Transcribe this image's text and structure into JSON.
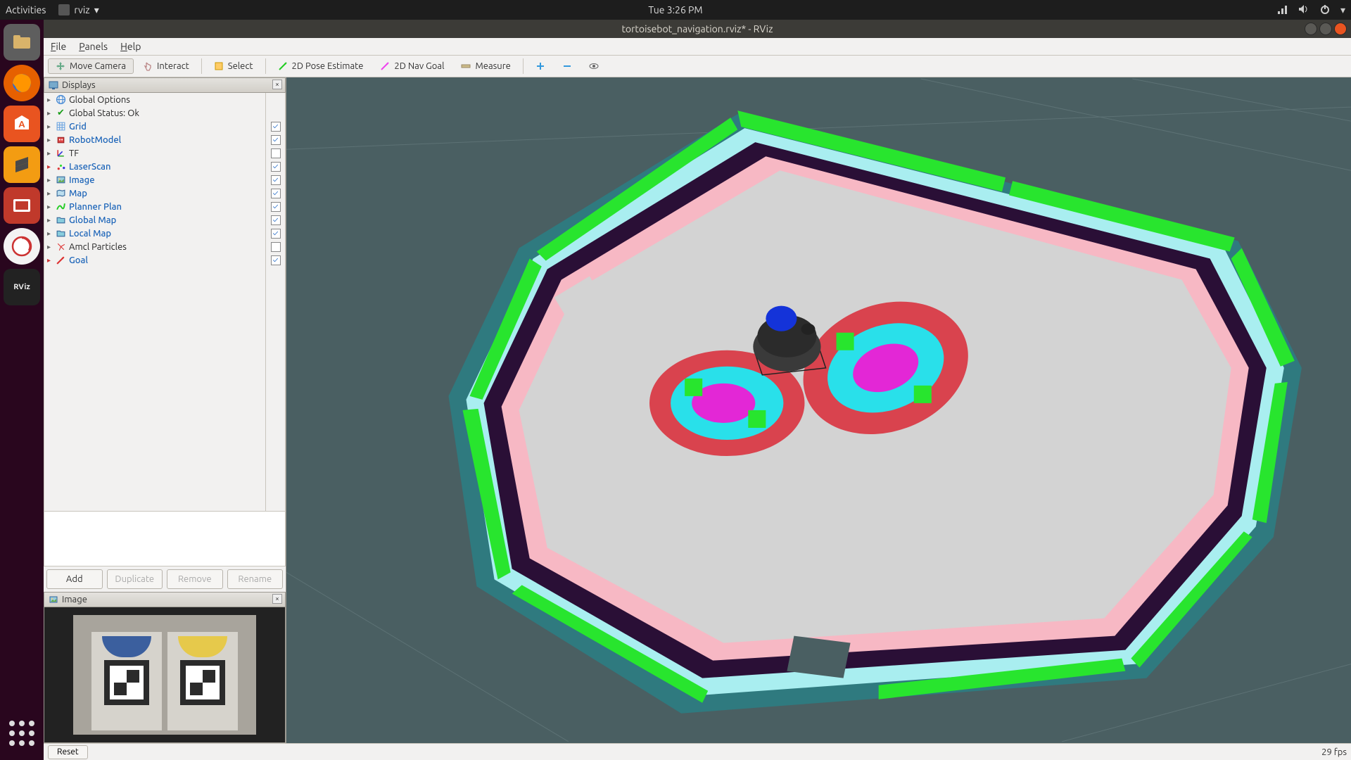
{
  "gnome": {
    "activities": "Activities",
    "app_name": "rviz",
    "clock": "Tue  3:26 PM"
  },
  "launcher": {
    "items": [
      "files",
      "firefox",
      "software",
      "sublime",
      "screenshot",
      "settings",
      "rviz"
    ],
    "rviz_label": "RViz"
  },
  "window": {
    "title": "tortoisebot_navigation.rviz* - RViz"
  },
  "menubar": {
    "file": "File",
    "panels": "Panels",
    "help": "Help"
  },
  "toolbar": {
    "move_camera": "Move Camera",
    "interact": "Interact",
    "select": "Select",
    "pose_estimate": "2D Pose Estimate",
    "nav_goal": "2D Nav Goal",
    "measure": "Measure"
  },
  "displays_panel": {
    "title": "Displays",
    "items": [
      {
        "label": "Global Options",
        "link": false,
        "check": null,
        "icon": "globe"
      },
      {
        "label": "Global Status: Ok",
        "link": false,
        "check": null,
        "icon": "ok"
      },
      {
        "label": "Grid",
        "link": true,
        "check": true,
        "icon": "grid"
      },
      {
        "label": "RobotModel",
        "link": true,
        "check": true,
        "icon": "robot"
      },
      {
        "label": "TF",
        "link": false,
        "check": false,
        "icon": "tf"
      },
      {
        "label": "LaserScan",
        "link": true,
        "check": true,
        "icon": "laser"
      },
      {
        "label": "Image",
        "link": true,
        "check": true,
        "icon": "image"
      },
      {
        "label": "Map",
        "link": true,
        "check": true,
        "icon": "map"
      },
      {
        "label": "Planner Plan",
        "link": true,
        "check": true,
        "icon": "plan"
      },
      {
        "label": "Global Map",
        "link": true,
        "check": true,
        "icon": "folder"
      },
      {
        "label": "Local Map",
        "link": true,
        "check": true,
        "icon": "folder"
      },
      {
        "label": "Amcl Particles",
        "link": false,
        "check": false,
        "icon": "particles"
      },
      {
        "label": "Goal",
        "link": true,
        "check": true,
        "icon": "goal"
      }
    ],
    "buttons": {
      "add": "Add",
      "duplicate": "Duplicate",
      "remove": "Remove",
      "rename": "Rename"
    }
  },
  "image_panel": {
    "title": "Image"
  },
  "statusbar": {
    "reset": "Reset",
    "fps": "29 fps"
  },
  "colors": {
    "viewport_bg": "#4a5f62",
    "map_floor": "#d3d3d3",
    "wall_dark": "#2a0f36",
    "inflation_pink": "#f7b8c4",
    "inflation_cyan": "#7fe3e8",
    "laser_green": "#28e52e",
    "costmap_red": "#d9333f",
    "costmap_cyan": "#29e0ea",
    "costmap_mag": "#e327d6",
    "robot_body": "#3a3a3a",
    "robot_lidar": "#1433d9"
  }
}
